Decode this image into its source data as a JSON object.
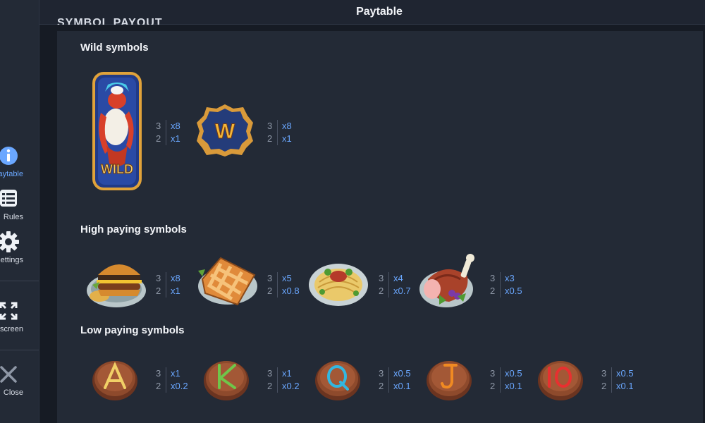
{
  "header": {
    "title": "Paytable"
  },
  "clipped_heading": "SYMBOL PAYOUT",
  "sidebar": {
    "items": [
      {
        "label": "Paytable",
        "icon": "info-icon",
        "active": true
      },
      {
        "label": "Rules",
        "icon": "list-icon"
      },
      {
        "label": "Settings",
        "icon": "gear-icon"
      },
      {
        "label": "Fullscreen",
        "icon": "fullscreen-icon"
      },
      {
        "label": "Close",
        "icon": "close-icon"
      }
    ]
  },
  "sections": {
    "wild": {
      "title": "Wild symbols",
      "symbols": [
        {
          "name": "wild-dragon",
          "pays": [
            {
              "count": "3",
              "mult": "x8"
            },
            {
              "count": "2",
              "mult": "x1"
            }
          ]
        },
        {
          "name": "w-badge",
          "pays": [
            {
              "count": "3",
              "mult": "x8"
            },
            {
              "count": "2",
              "mult": "x1"
            }
          ]
        }
      ]
    },
    "high": {
      "title": "High paying symbols",
      "symbols": [
        {
          "name": "burger",
          "pays": [
            {
              "count": "3",
              "mult": "x8"
            },
            {
              "count": "2",
              "mult": "x1"
            }
          ]
        },
        {
          "name": "pie",
          "pays": [
            {
              "count": "3",
              "mult": "x5"
            },
            {
              "count": "2",
              "mult": "x0.8"
            }
          ]
        },
        {
          "name": "pasta",
          "pays": [
            {
              "count": "3",
              "mult": "x4"
            },
            {
              "count": "2",
              "mult": "x0.7"
            }
          ]
        },
        {
          "name": "ham",
          "pays": [
            {
              "count": "3",
              "mult": "x3"
            },
            {
              "count": "2",
              "mult": "x0.5"
            }
          ]
        }
      ]
    },
    "low": {
      "title": "Low paying symbols",
      "symbols": [
        {
          "name": "A",
          "color": "#f1d067",
          "pays": [
            {
              "count": "3",
              "mult": "x1"
            },
            {
              "count": "2",
              "mult": "x0.2"
            }
          ]
        },
        {
          "name": "K",
          "color": "#6fc64a",
          "pays": [
            {
              "count": "3",
              "mult": "x1"
            },
            {
              "count": "2",
              "mult": "x0.2"
            }
          ]
        },
        {
          "name": "Q",
          "color": "#33b7e0",
          "pays": [
            {
              "count": "3",
              "mult": "x0.5"
            },
            {
              "count": "2",
              "mult": "x0.1"
            }
          ]
        },
        {
          "name": "J",
          "color": "#f08a22",
          "pays": [
            {
              "count": "3",
              "mult": "x0.5"
            },
            {
              "count": "2",
              "mult": "x0.1"
            }
          ]
        },
        {
          "name": "10",
          "color": "#e83030",
          "pays": [
            {
              "count": "3",
              "mult": "x0.5"
            },
            {
              "count": "2",
              "mult": "x0.1"
            }
          ]
        }
      ]
    }
  },
  "symbol_text": {
    "wild": "WILD",
    "w": "W"
  },
  "colors": {
    "accent": "#6aa7ff",
    "panel": "#232a36",
    "background": "#161b24"
  }
}
